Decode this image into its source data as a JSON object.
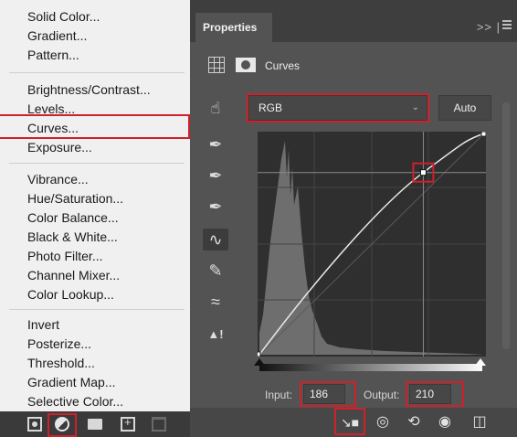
{
  "adjustments_menu": {
    "groups": [
      [
        "Solid Color...",
        "Gradient...",
        "Pattern..."
      ],
      [
        "Brightness/Contrast...",
        "Levels...",
        "Curves...",
        "Exposure..."
      ],
      [
        "Vibrance...",
        "Hue/Saturation...",
        "Color Balance...",
        "Black & White...",
        "Photo Filter...",
        "Channel Mixer...",
        "Color Lookup..."
      ],
      [
        "Invert",
        "Posterize...",
        "Threshold...",
        "Gradient Map...",
        "Selective Color..."
      ]
    ],
    "highlighted_item": "Curves..."
  },
  "layers_bottom_bar": {
    "icons": [
      "mask-icon",
      "adjustment-layer-icon",
      "folder-icon",
      "new-layer-icon",
      "trash-icon"
    ]
  },
  "properties_panel": {
    "tab_title": "Properties",
    "header_controls": ">> |",
    "adjustment_name": "Curves",
    "preset_channel": "RGB",
    "auto_label": "Auto",
    "input_label": "Input:",
    "input_value": "186",
    "output_label": "Output:",
    "output_value": "210",
    "curve_point": {
      "input": 186,
      "output": 210
    },
    "tools": [
      "on-image-adjust-icon",
      "sample-black-eyedropper-icon",
      "sample-gray-eyedropper-icon",
      "sample-white-eyedropper-icon",
      "edit-points-curve-icon",
      "draw-pencil-icon",
      "smooth-curve-icon",
      "clipping-warning-icon"
    ],
    "bottom_icons": [
      "clip-to-layer-icon",
      "view-previous-icon",
      "reset-icon",
      "visibility-eye-icon",
      "trash-icon"
    ]
  },
  "colors": {
    "highlight_box": "#d0202a",
    "panel_bg": "#535353",
    "menu_bg": "#f0f0f0"
  }
}
